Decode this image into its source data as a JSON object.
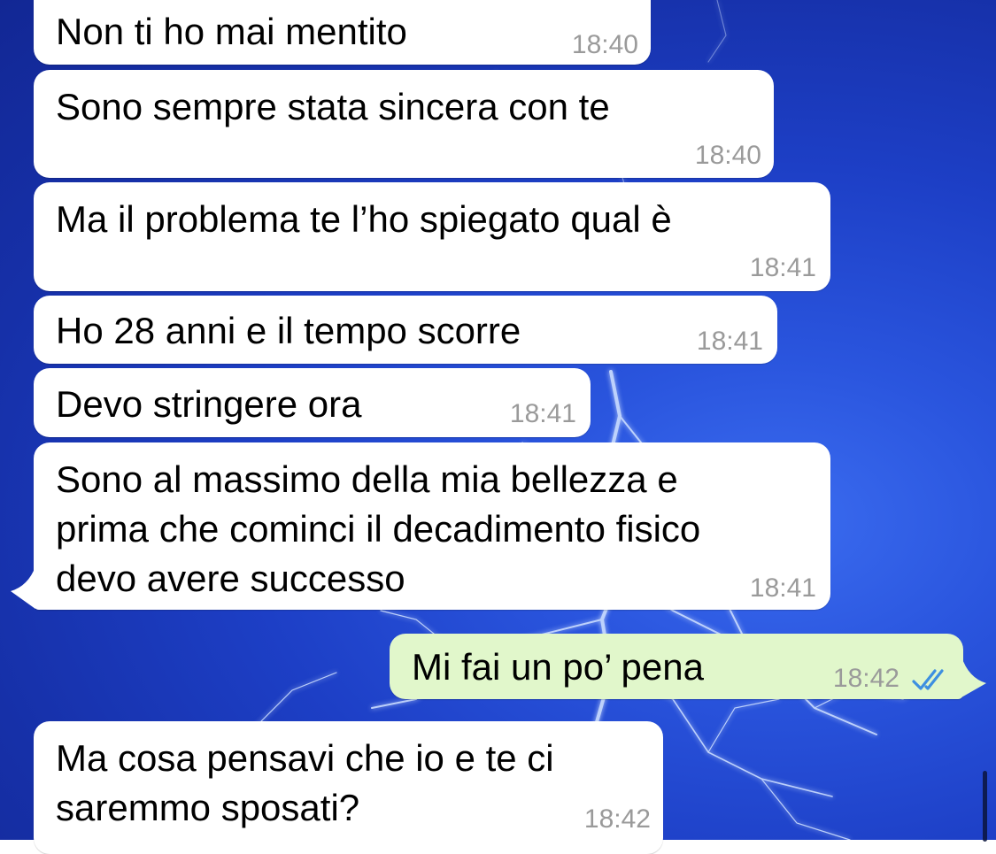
{
  "chat": {
    "messages": [
      {
        "direction": "in",
        "text": "Non ti ho mai mentito",
        "time": "18:40"
      },
      {
        "direction": "in",
        "text": "Sono sempre stata sincera con te",
        "time": "18:40"
      },
      {
        "direction": "in",
        "text": "Ma il problema te l’ho spiegato qual è",
        "time": "18:41"
      },
      {
        "direction": "in",
        "text": "Ho 28 anni e il tempo scorre",
        "time": "18:41"
      },
      {
        "direction": "in",
        "text": "Devo stringere ora",
        "time": "18:41"
      },
      {
        "direction": "in",
        "text": "Sono al massimo della mia bellezza e\nprima che cominci il decadimento fisico\ndevo avere successo",
        "time": "18:41"
      },
      {
        "direction": "out",
        "text": "Mi fai un po’ pena",
        "time": "18:42",
        "status": "read",
        "status_icon": "double-check-icon"
      },
      {
        "direction": "in",
        "text": "Ma cosa pensavi che io e te ci\nsaremmo sposati?",
        "time": "18:42"
      }
    ]
  },
  "colors": {
    "incoming_bubble": "#ffffff",
    "outgoing_bubble": "#e1f7cb",
    "timestamp": "#9a9a9a",
    "read_ticks": "#3d8fe0",
    "wallpaper": "#1d3fc6"
  },
  "wallpaper": {
    "description_icon": "lightning-wallpaper"
  }
}
